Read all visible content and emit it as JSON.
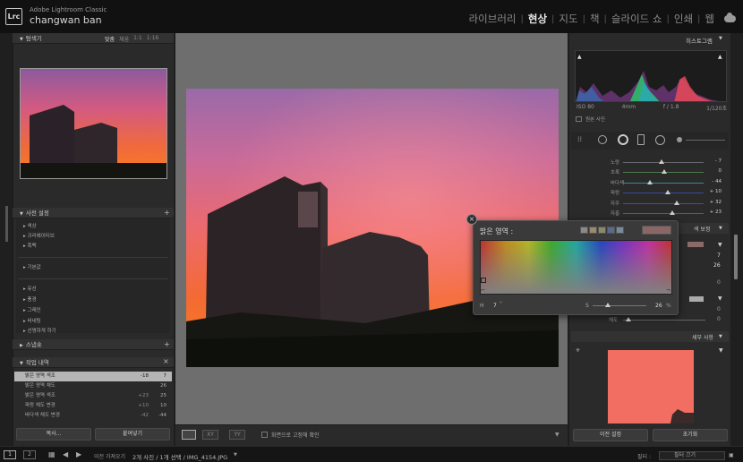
{
  "app": {
    "logo_text": "Lrc",
    "title": "Adobe Lightroom Classic",
    "user": "changwan ban"
  },
  "modules": [
    "라이브러리",
    "현상",
    "지도",
    "책",
    "슬라이드 쇼",
    "인쇄",
    "웹"
  ],
  "active_module": "현상",
  "navigator": {
    "title": "탐색기",
    "zoom_options": [
      "맞춤",
      "채움",
      "1:1",
      "1:16"
    ]
  },
  "presets": {
    "title": "사전 설정",
    "group1": [
      "색상",
      "크리에이티브",
      "흑백"
    ],
    "group2": [
      "기본값"
    ],
    "group3": [
      "유선",
      "풍경",
      "그레인",
      "비네팅",
      "선명하게 하기"
    ]
  },
  "snapshots": {
    "title": "스냅숏"
  },
  "history": {
    "title": "작업 내역",
    "rows": [
      {
        "label": "밝은 영역 색조",
        "v1": "-18",
        "v2": "7",
        "selected": true
      },
      {
        "label": "밝은 영역 채도",
        "v1": "",
        "v2": "26",
        "selected": false
      },
      {
        "label": "밝은 영역 색조",
        "v1": "+23",
        "v2": "25",
        "selected": false
      },
      {
        "label": "파랑 채도 변경",
        "v1": "+10",
        "v2": "10",
        "selected": false
      },
      {
        "label": "바다색 채도 변경",
        "v1": "-42",
        "v2": "-44",
        "selected": false
      }
    ]
  },
  "left_buttons": {
    "copy": "복사...",
    "paste": "붙여넣기"
  },
  "center_toolbar": {
    "checkbox_label": "화면으로 고정해 확인"
  },
  "histogram": {
    "title": "히스토그램",
    "iso": "ISO 80",
    "focal": "4mm",
    "aperture": "f / 1.8",
    "shutter": "1/120초",
    "original_photo": "원본 사진"
  },
  "hsl_sliders": [
    {
      "label": "노랑",
      "value": "- 7"
    },
    {
      "label": "초록",
      "value": "0"
    },
    {
      "label": "바다색",
      "value": "- 44"
    },
    {
      "label": "파랑",
      "value": "+ 10"
    },
    {
      "label": "자주",
      "value": "+ 32"
    },
    {
      "label": "자홍",
      "value": "+ 23"
    }
  ],
  "color_grading": {
    "title": "색 보정",
    "values": [
      "7",
      "26",
      "0",
      "0",
      "0"
    ],
    "saturation_label": "채도"
  },
  "popup": {
    "title": "밝은 영역 :",
    "hue_label": "H",
    "hue_value": "7",
    "sat_label": "S",
    "sat_value": "26",
    "percent": "%"
  },
  "detail": {
    "title": "세부 사항"
  },
  "right_buttons": {
    "previous": "이전 설정",
    "reset": "초기화"
  },
  "bottom": {
    "page1": "1",
    "page2": "2",
    "import_label": "이전 가져오기",
    "selection": "2개 사진 / 1개 선택 / IMG_4154.JPG",
    "filter_label": "필터 :",
    "filter_value": "필터 끄기"
  },
  "colors": {
    "accent_active": "#e6e6e6",
    "selection": "#b5b5b5",
    "panel": "#2a2a2a"
  }
}
